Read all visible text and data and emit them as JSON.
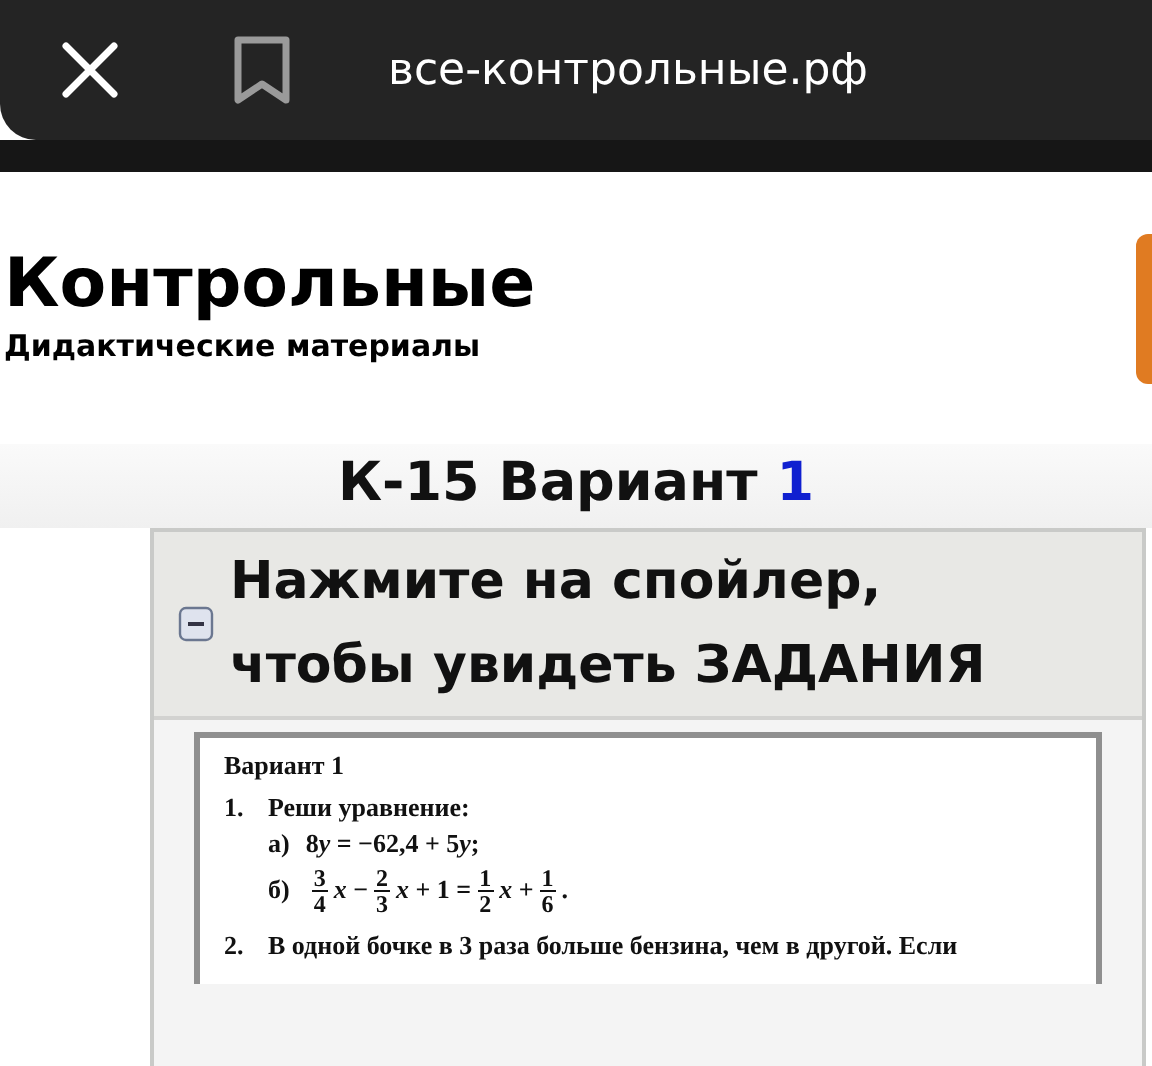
{
  "browser": {
    "url": "все-контрольные.рф"
  },
  "site": {
    "title": "Контрольные",
    "subtitle": "Дидактические материалы"
  },
  "page": {
    "heading": "К-15 Вариант",
    "heading_number": "1"
  },
  "spoiler": {
    "expanded": true,
    "label_lines": [
      "Нажмите на спойлер,",
      "чтобы увидеть ЗАДАНИЯ"
    ]
  },
  "document": {
    "title": "Вариант 1",
    "tasks": [
      {
        "number": "1.",
        "text": "Реши уравнение:",
        "items": [
          {
            "label": "а)",
            "parts": [
              {
                "kind": "text",
                "text": "8"
              },
              {
                "kind": "var",
                "text": "y"
              },
              {
                "kind": "text",
                "text": " = −62,4 + 5"
              },
              {
                "kind": "var",
                "text": "y"
              },
              {
                "kind": "text",
                "text": ";"
              }
            ]
          },
          {
            "label": "б)",
            "parts": [
              {
                "kind": "frac",
                "num": "3",
                "den": "4"
              },
              {
                "kind": "var",
                "text": "x"
              },
              {
                "kind": "text",
                "text": " −"
              },
              {
                "kind": "frac",
                "num": "2",
                "den": "3"
              },
              {
                "kind": "var",
                "text": "x"
              },
              {
                "kind": "text",
                "text": " + 1 ="
              },
              {
                "kind": "frac",
                "num": "1",
                "den": "2"
              },
              {
                "kind": "var",
                "text": "x"
              },
              {
                "kind": "text",
                "text": " +"
              },
              {
                "kind": "frac",
                "num": "1",
                "den": "6"
              },
              {
                "kind": "text",
                "text": "."
              }
            ]
          }
        ]
      },
      {
        "number": "2.",
        "text": "В одной бочке в 3 раза больше бензина, чем в другой. Если"
      }
    ]
  }
}
